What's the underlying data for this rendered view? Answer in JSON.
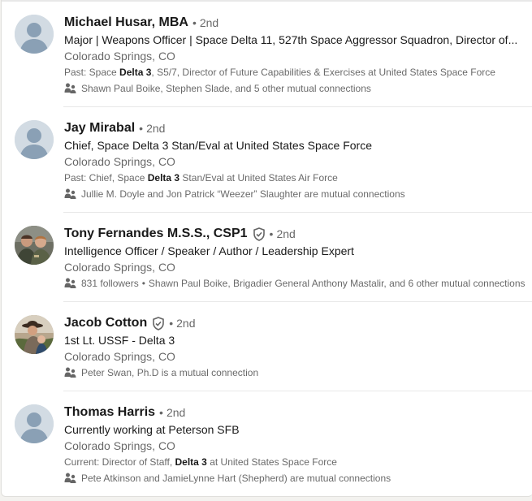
{
  "results": [
    {
      "name": "Michael Husar, MBA",
      "verified": false,
      "degree": "2nd",
      "headline": "Major | Weapons Officer | Space Delta 11, 527th Space Aggressor Squadron, Director of...",
      "location": "Colorado Springs, CO",
      "summary_prefix": "Past: Space ",
      "summary_bold": "Delta 3",
      "summary_suffix": ", S5/7, Director of Future Capabilities & Exercises at United States Space Force",
      "mutual": "Shawn Paul Boike, Stephen Slade, and 5 other mutual connections",
      "followers": "",
      "avatar": "placeholder"
    },
    {
      "name": "Jay Mirabal",
      "verified": false,
      "degree": "2nd",
      "headline": "Chief, Space Delta 3 Stan/Eval at United States Space Force",
      "location": "Colorado Springs, CO",
      "summary_prefix": "Past: Chief, Space ",
      "summary_bold": "Delta 3",
      "summary_suffix": " Stan/Eval at United States Air Force",
      "mutual": "Jullie M. Doyle and Jon Patrick “Weezer” Slaughter are mutual connections",
      "followers": "",
      "avatar": "placeholder"
    },
    {
      "name": "Tony Fernandes M.S.S., CSP1",
      "verified": true,
      "degree": "2nd",
      "headline": "Intelligence Officer / Speaker / Author / Leadership Expert",
      "location": "Colorado Springs, CO",
      "summary_prefix": "",
      "summary_bold": "",
      "summary_suffix": "",
      "mutual": "Shawn Paul Boike, Brigadier General Anthony Mastalir, and 6 other mutual connections",
      "followers": "831 followers",
      "avatar": "photo"
    },
    {
      "name": "Jacob Cotton",
      "verified": true,
      "degree": "2nd",
      "headline": "1st Lt. USSF - Delta 3",
      "location": "Colorado Springs, CO",
      "summary_prefix": "",
      "summary_bold": "",
      "summary_suffix": "",
      "mutual": "Peter Swan, Ph.D is a mutual connection",
      "followers": "",
      "avatar": "photo"
    },
    {
      "name": "Thomas Harris",
      "verified": false,
      "degree": "2nd",
      "headline": "Currently working at Peterson SFB",
      "location": "Colorado Springs, CO",
      "summary_prefix": "Current: Director of Staff, ",
      "summary_bold": "Delta 3",
      "summary_suffix": " at United States Space Force",
      "mutual": "Pete Atkinson and JamieLynne Hart (Shepherd) are mutual connections",
      "followers": "",
      "avatar": "placeholder"
    }
  ],
  "degree_separator": "•",
  "icons": {
    "verified": "shield-check-icon",
    "mutual": "people-icon",
    "avatar": "person-silhouette-icon"
  },
  "colors": {
    "primary_text": "#191919",
    "secondary_text": "#666666",
    "avatar_bg": "#d2dbe3",
    "avatar_figure": "#8aa0b5"
  }
}
